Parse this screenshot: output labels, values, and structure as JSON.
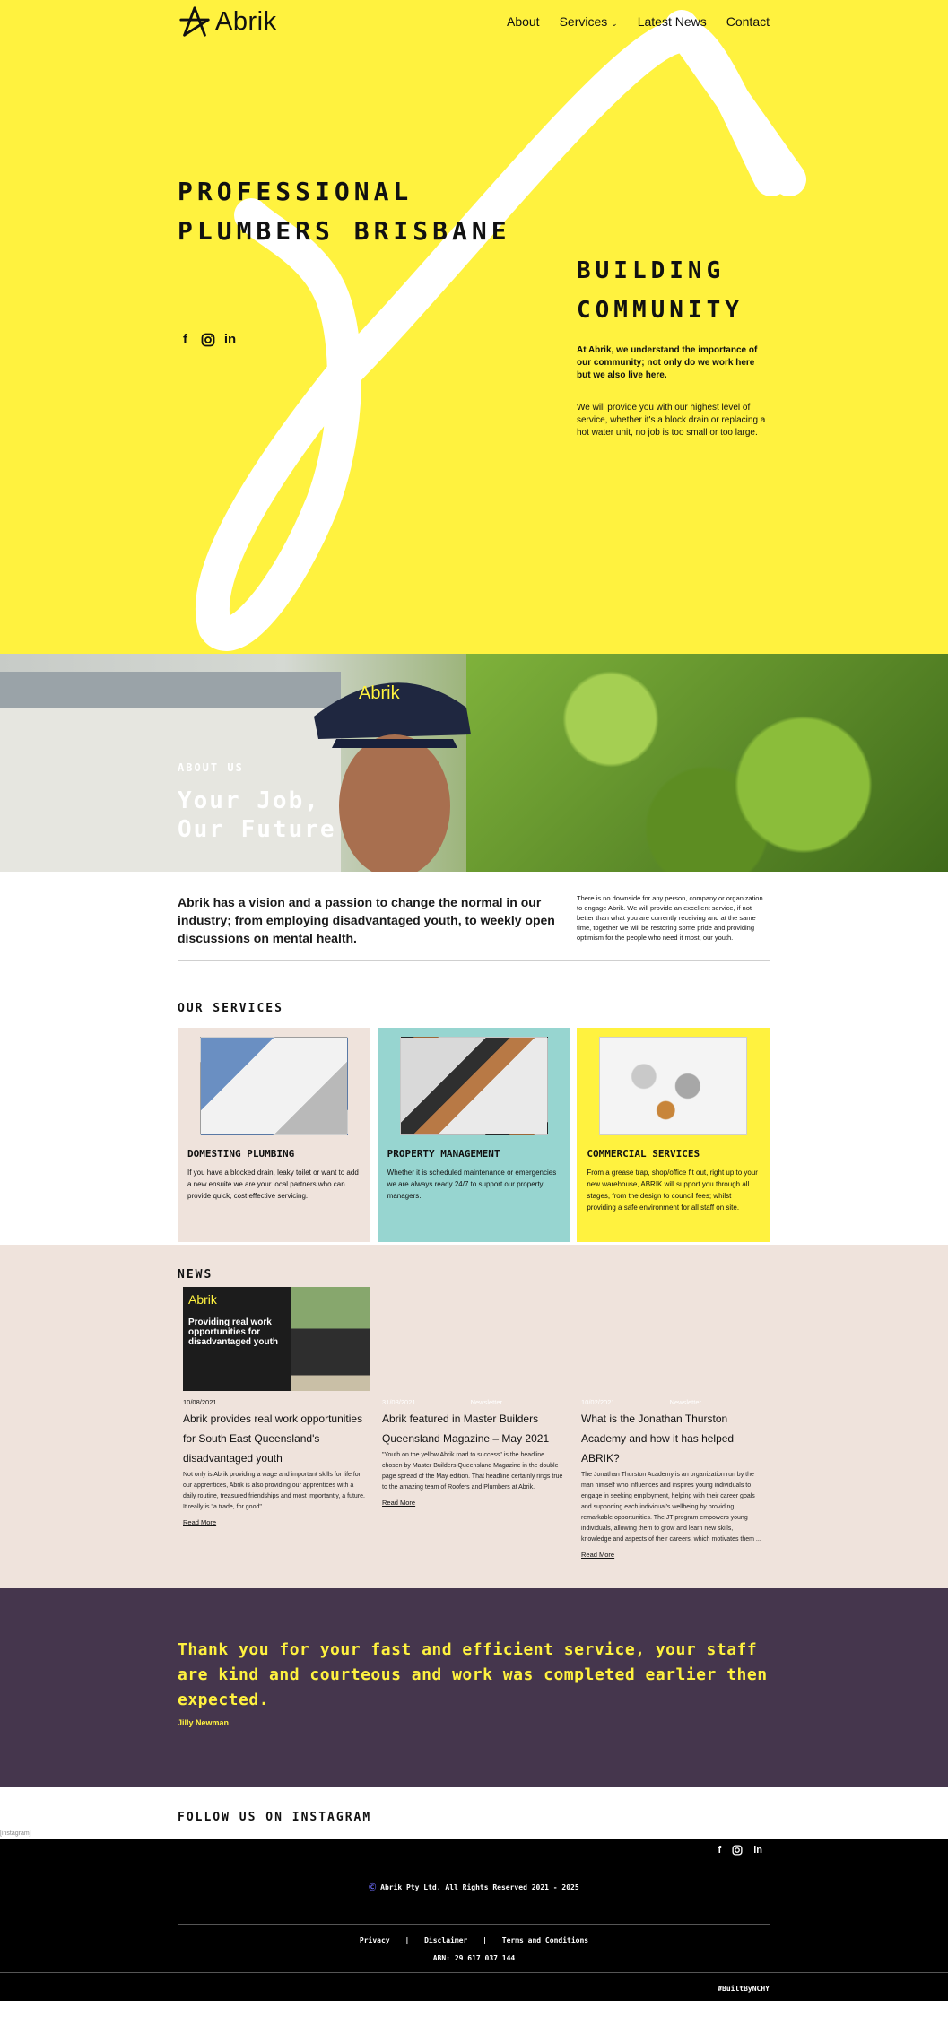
{
  "brand": {
    "name": "Abrik",
    "accent": "#fff23f",
    "purple": "#45364d",
    "beige": "#efe3dc",
    "teal": "#97d5d0"
  },
  "nav": {
    "items": [
      "About",
      "Services",
      "Latest News",
      "Contact"
    ]
  },
  "hero": {
    "title_line1": "PROFESSIONAL",
    "title_line2": "PLUMBERS BRISBANE",
    "side_title_line1": "BUILDING",
    "side_title_line2": "COMMUNITY",
    "para1": "At Abrik, we understand the importance of our community; not only do we work here but we also live here.",
    "para2": "We will provide you with our highest level of service, whether it's a block drain or replacing a hot water unit, no job is too small or too large.",
    "social_icons": [
      "facebook-icon",
      "instagram-icon",
      "linkedin-icon"
    ]
  },
  "about": {
    "label": "ABOUT US",
    "title_line1": "Your Job,",
    "title_line2": "Our Future",
    "cap_text": "Abrik"
  },
  "intro": {
    "lead": "Abrik has a vision and a passion to change the normal in our industry; from employing disadvantaged youth, to weekly open discussions on mental health.",
    "side": "There is no downside for any person, company or organization to engage Abrik. We will provide an excellent service, if not better than what you are currently receiving and at the same time, together we will be restoring some pride and providing optimism for the people who need it most, our youth."
  },
  "services": {
    "title": "OUR SERVICES",
    "cards": [
      {
        "title": "DOMESTING PLUMBING",
        "text": "If you have a blocked drain, leaky toilet or want to add a new ensuite we are your local partners who can provide quick, cost effective servicing.",
        "bg": "#efe3dc"
      },
      {
        "title": "PROPERTY MANAGEMENT",
        "text": "Whether it is scheduled maintenance or emergencies we are always ready 24/7 to support our property managers.",
        "bg": "#97d5d0"
      },
      {
        "title": "COMMERCIAL SERVICES",
        "text": "From a grease trap, shop/office fit out, right up to your new warehouse, ABRIK will support you through all stages, from the design to council fees; whilst providing a safe environment for all staff on site.",
        "bg": "#fff23f"
      }
    ]
  },
  "news": {
    "title": "NEWS",
    "posts": [
      {
        "thumb_logo": "Abrik",
        "thumb_overlay": "Providing real work opportunities for disadvantaged youth",
        "date": "10/08/2021",
        "category": "",
        "title": "Abrik provides real work opportunities for South East Queensland's disadvantaged youth",
        "excerpt": "Not only is Abrik providing a wage and important skills for life for our apprentices, Abrik is also providing our apprentices with a daily routine, treasured friendships and most importantly, a future. It really is \"a trade, for good\".",
        "read_more": "Read More"
      },
      {
        "date": "31/08/2021",
        "category": "Newsletter",
        "title": "Abrik featured in Master Builders Queensland Magazine – May 2021",
        "excerpt": "\"Youth on the yellow Abrik road to success\" is the headline chosen by Master Builders Queensland Magazine in the double page spread of the May edition. That headline certainly rings true to the amazing team of Roofers and Plumbers at Abrik.",
        "read_more": "Read More"
      },
      {
        "date": "10/02/2021",
        "category": "Newsletter",
        "title": "What is the Jonathan Thurston Academy and how it has helped ABRIK?",
        "excerpt": "The Jonathan Thurston Academy is an organization run by the man himself who influences and inspires young individuals to engage in seeking employment, helping with their career goals and supporting each individual's wellbeing by providing remarkable opportunities. The JT program empowers young individuals, allowing them to grow and learn new skills, knowledge and aspects of their careers, which motivates them ...",
        "read_more": "Read More"
      }
    ]
  },
  "testimonial": {
    "quote": "Thank you for your fast and efficient service, your staff are kind and courteous and work was completed earlier then expected.",
    "author": "Jilly Newman"
  },
  "instagram": {
    "title": "FOLLOW US ON INSTAGRAM",
    "placeholder": "[instagram]"
  },
  "footer": {
    "copyright": "Abrik Pty Ltd. All Rights Reserved 2021 - 2025",
    "copyright_symbol": "Ⓒ",
    "links": [
      "Privacy",
      "Disclaimer",
      "Terms and Conditions"
    ],
    "separator": "|",
    "abn": "ABN: 29 617 037 144",
    "hashtag": "#BuiltByNCHY"
  }
}
